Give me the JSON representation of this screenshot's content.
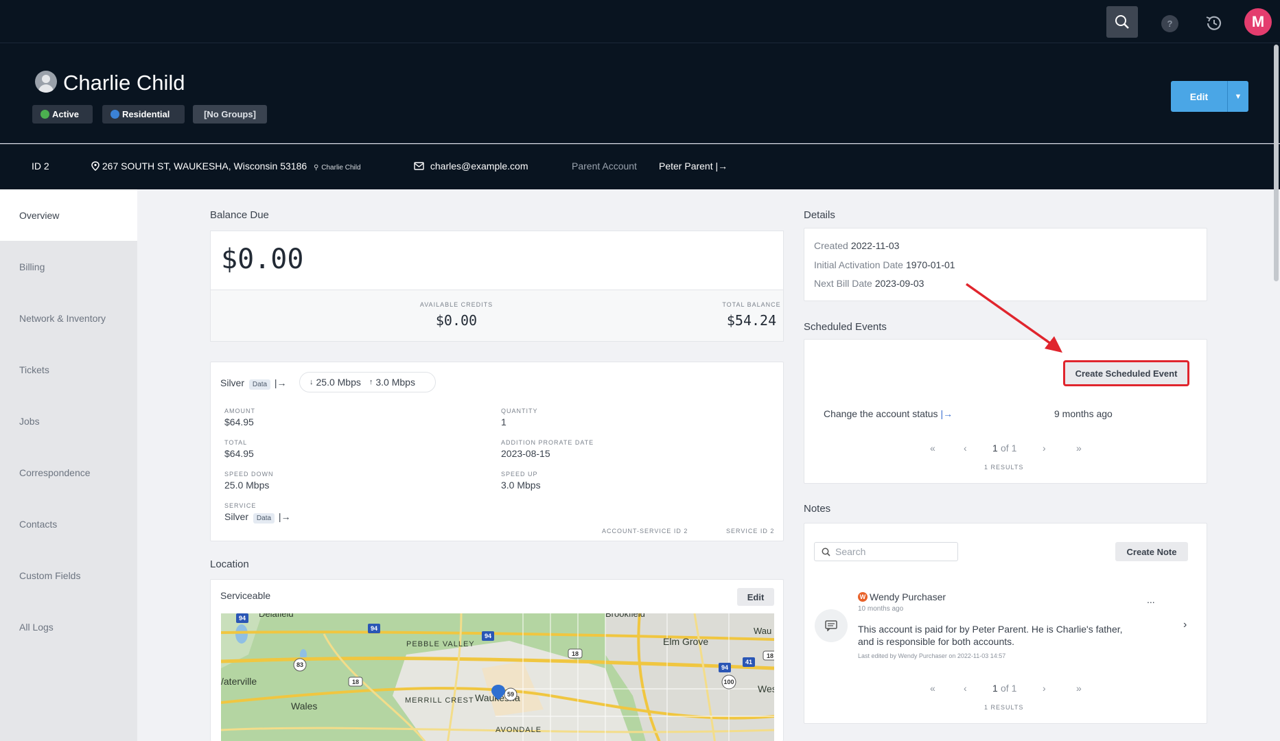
{
  "topbar": {
    "help_label": "?",
    "avatar_initial": "M",
    "icons": [
      "search-icon",
      "help-icon",
      "history-icon"
    ]
  },
  "account": {
    "name": "Charlie Child",
    "badges": {
      "status": "Active",
      "status_color": "#4caf50",
      "type": "Residential",
      "type_color": "#3b82d6",
      "groups": "[No Groups]"
    },
    "edit_label": "Edit"
  },
  "info_bar": {
    "id_label": "ID 2",
    "address": "267 SOUTH ST, WAUKESHA, Wisconsin 53186",
    "address_contact": "Charlie Child",
    "email": "charles@example.com",
    "parent_label": "Parent Account",
    "parent_name": "Peter Parent"
  },
  "sidebar": {
    "items": [
      {
        "label": "Overview",
        "active": true
      },
      {
        "label": "Billing"
      },
      {
        "label": "Network & Inventory"
      },
      {
        "label": "Tickets"
      },
      {
        "label": "Jobs"
      },
      {
        "label": "Correspondence"
      },
      {
        "label": "Contacts"
      },
      {
        "label": "Custom Fields"
      },
      {
        "label": "All Logs"
      }
    ]
  },
  "balance": {
    "title": "Balance Due",
    "amount": "$0.00",
    "available_credits_label": "AVAILABLE CREDITS",
    "available_credits": "$0.00",
    "total_balance_label": "TOTAL BALANCE",
    "total_balance": "$54.24"
  },
  "plan": {
    "name": "Silver",
    "tag": "Data",
    "speed_down": "25.0 Mbps",
    "speed_up": "3.0 Mbps",
    "fields": {
      "amount_label": "AMOUNT",
      "amount": "$64.95",
      "quantity_label": "QUANTITY",
      "quantity": "1",
      "total_label": "TOTAL",
      "total": "$64.95",
      "prorate_label": "ADDITION PRORATE DATE",
      "prorate": "2023-08-15",
      "speed_down_label": "SPEED DOWN",
      "speed_down": "25.0 Mbps",
      "speed_up_label": "SPEED UP",
      "speed_up": "3.0 Mbps",
      "service_label": "SERVICE",
      "service": "Silver",
      "service_tag": "Data"
    },
    "account_service_id": "ACCOUNT-SERVICE ID 2",
    "service_id": "SERVICE ID 2"
  },
  "location": {
    "title": "Location",
    "status": "Serviceable",
    "edit_label": "Edit",
    "map_labels": {
      "delafield": "Delafield",
      "brookfield": "Brookfield",
      "wau": "Wau",
      "pebble_valley": "PEBBLE VALLEY",
      "elm_grove": "Elm Grove",
      "waterville": "/aterville",
      "wales": "Wales",
      "merrill_crest": "MERRILL CREST",
      "waukesha": "Waukesha",
      "avondale": "AVONDALE",
      "wes": "Wes"
    },
    "map_shields": {
      "i94a": "94",
      "i94b": "94",
      "i94c": "94",
      "i94d": "94",
      "r83": "83",
      "r18a": "18",
      "r18b": "18",
      "r18c": "18",
      "r59": "59",
      "r100": "100",
      "i41": "41"
    }
  },
  "details": {
    "title": "Details",
    "created_label": "Created",
    "created": "2022-11-03",
    "activation_label": "Initial Activation Date",
    "activation": "1970-01-01",
    "next_bill_label": "Next Bill Date",
    "next_bill": "2023-09-03"
  },
  "scheduled_events": {
    "title": "Scheduled Events",
    "create_label": "Create Scheduled Event",
    "event_text": "Change the account status",
    "event_time": "9 months ago",
    "pager": {
      "first": "«",
      "prev": "‹",
      "page": "1",
      "of": "of 1",
      "next": "›",
      "last": "»"
    },
    "results": "1 RESULTS"
  },
  "notes": {
    "title": "Notes",
    "search_placeholder": "Search",
    "create_label": "Create Note",
    "note": {
      "author_initial": "W",
      "author": "Wendy Purchaser",
      "time": "10 months ago",
      "menu": "...",
      "text_line1": "This account is paid for by Peter Parent. He is Charlie's father,",
      "text_line2": "and is responsible for both accounts.",
      "edited": "Last edited by Wendy Purchaser on 2022-11-03 14:57"
    },
    "pager": {
      "first": "«",
      "prev": "‹",
      "page": "1",
      "of": "of 1",
      "next": "›",
      "last": "»"
    },
    "results": "1 RESULTS"
  }
}
